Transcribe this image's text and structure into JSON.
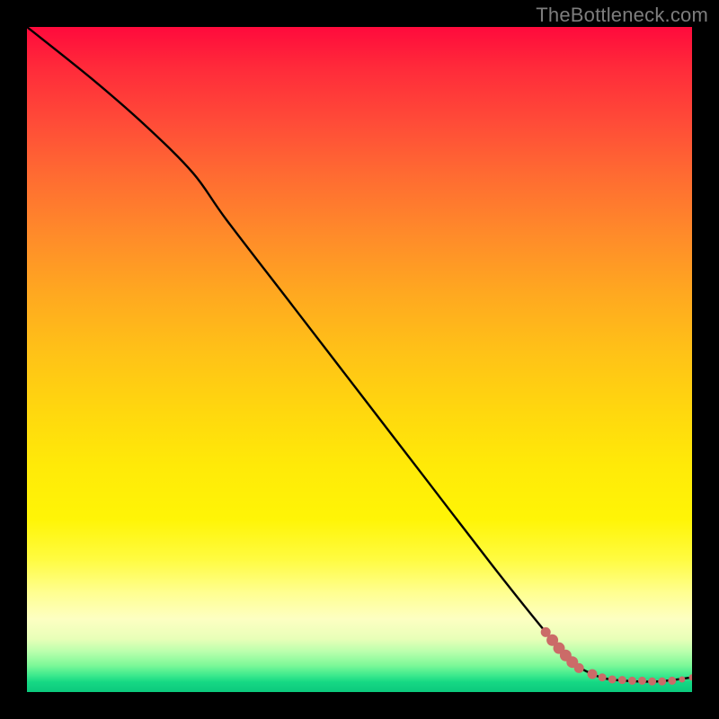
{
  "watermark": "TheBottleneck.com",
  "colors": {
    "background": "#000000",
    "curve": "#000000",
    "dots": "#cb6b68",
    "gradient_top": "#ff0a3c",
    "gradient_bottom": "#0cc97d"
  },
  "chart_data": {
    "type": "line",
    "title": "",
    "xlabel": "",
    "ylabel": "",
    "xlim": [
      0,
      100
    ],
    "ylim": [
      0,
      100
    ],
    "grid": false,
    "legend": false,
    "curve": [
      {
        "x": 0,
        "y": 100
      },
      {
        "x": 10,
        "y": 92
      },
      {
        "x": 18,
        "y": 85
      },
      {
        "x": 25,
        "y": 78
      },
      {
        "x": 30,
        "y": 71
      },
      {
        "x": 40,
        "y": 58
      },
      {
        "x": 50,
        "y": 45
      },
      {
        "x": 60,
        "y": 32
      },
      {
        "x": 70,
        "y": 19
      },
      {
        "x": 78,
        "y": 9
      },
      {
        "x": 82,
        "y": 4.5
      },
      {
        "x": 86,
        "y": 2.3
      },
      {
        "x": 90,
        "y": 1.7
      },
      {
        "x": 95,
        "y": 1.6
      },
      {
        "x": 100,
        "y": 2.2
      }
    ],
    "dots": [
      {
        "x": 78,
        "y": 9.0,
        "r": 5
      },
      {
        "x": 79,
        "y": 7.8,
        "r": 6
      },
      {
        "x": 80,
        "y": 6.6,
        "r": 6
      },
      {
        "x": 81,
        "y": 5.5,
        "r": 6
      },
      {
        "x": 82,
        "y": 4.5,
        "r": 6
      },
      {
        "x": 83,
        "y": 3.6,
        "r": 5
      },
      {
        "x": 85,
        "y": 2.7,
        "r": 5
      },
      {
        "x": 86.5,
        "y": 2.2,
        "r": 4
      },
      {
        "x": 88,
        "y": 1.9,
        "r": 4
      },
      {
        "x": 89.5,
        "y": 1.8,
        "r": 4
      },
      {
        "x": 91,
        "y": 1.7,
        "r": 4
      },
      {
        "x": 92.5,
        "y": 1.7,
        "r": 4
      },
      {
        "x": 94,
        "y": 1.6,
        "r": 4
      },
      {
        "x": 95.5,
        "y": 1.6,
        "r": 4
      },
      {
        "x": 97,
        "y": 1.7,
        "r": 4
      },
      {
        "x": 98.5,
        "y": 1.9,
        "r": 3
      },
      {
        "x": 100,
        "y": 2.2,
        "r": 3
      }
    ]
  }
}
